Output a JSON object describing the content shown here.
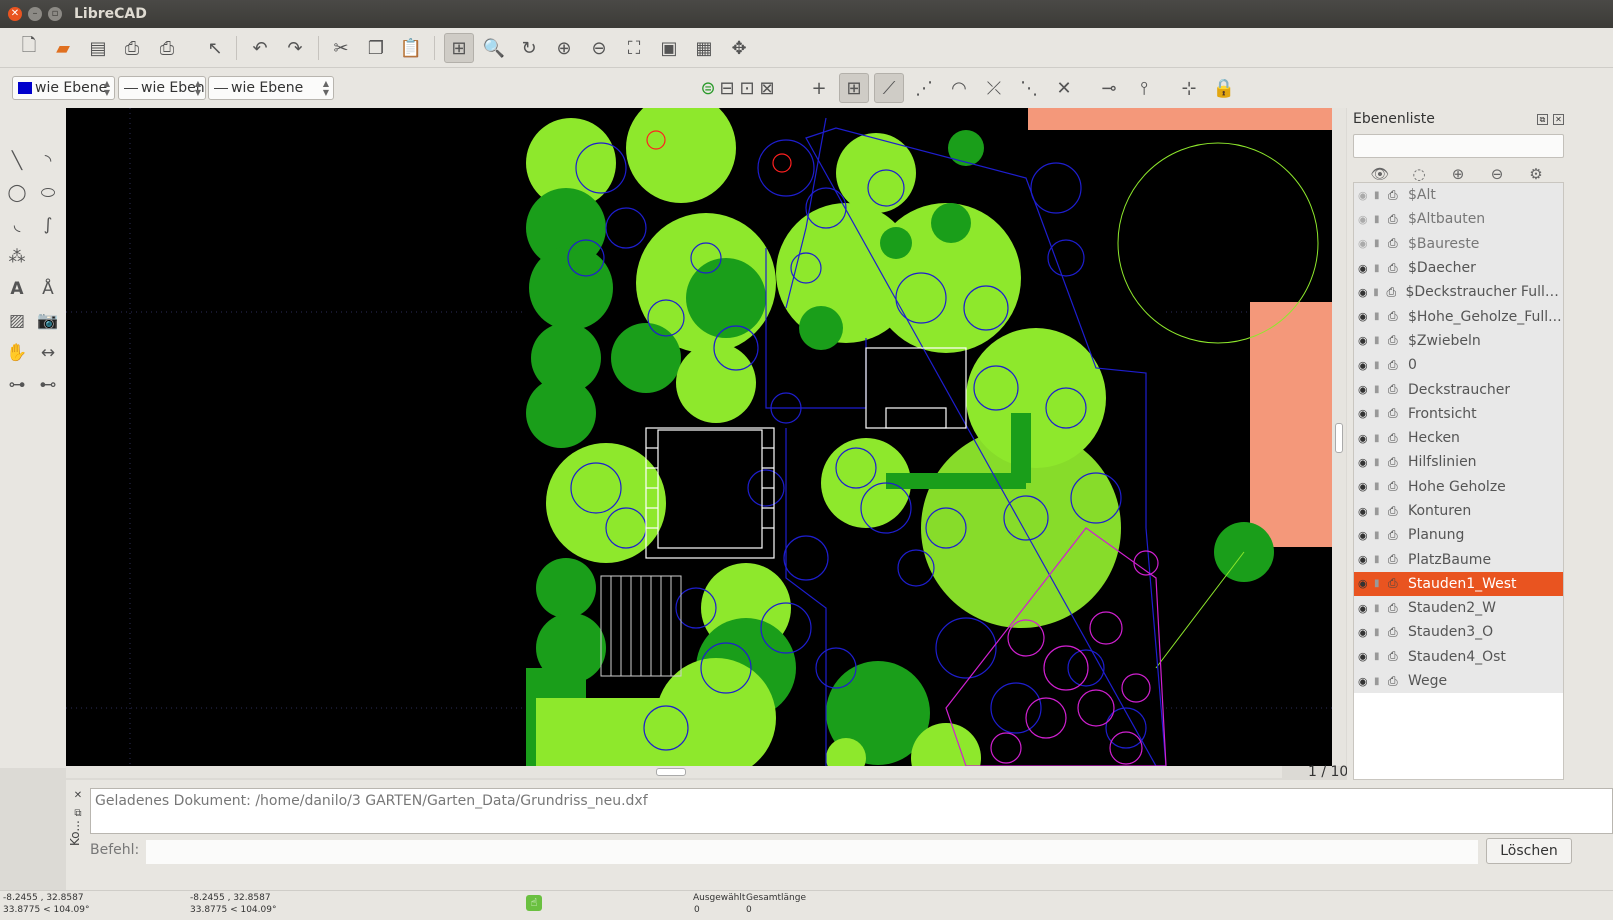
{
  "window": {
    "title": "LibreCAD"
  },
  "pen_toolbar": {
    "color_label": "wie Ebene",
    "color_swatch": "#0000cc",
    "linetype_label": "wie Ebene",
    "linewidth_label": "wie Ebene"
  },
  "toolbar_icons": {
    "file": [
      "new-icon",
      "open-icon",
      "save-icon",
      "print-icon",
      "print-preview-icon",
      "select-pointer-icon"
    ],
    "edit": [
      "undo-icon",
      "redo-icon",
      "cut-icon",
      "copy-icon",
      "paste-icon"
    ],
    "view": [
      "grid-icon",
      "zoom-pan-icon",
      "redraw-icon",
      "zoom-in-icon",
      "zoom-out-icon",
      "zoom-auto-icon",
      "zoom-previous-icon",
      "zoom-window-icon",
      "zoom-pan-tool-icon"
    ],
    "snap": [
      "snap-free-icon",
      "snap-exclusive-icon",
      "snap-grid-icon",
      "snap-endpoint-icon",
      "snap-onentity-icon",
      "snap-center-icon",
      "snap-middle-icon",
      "snap-distance-icon",
      "snap-intersection-icon",
      "restrict-horizontal-icon",
      "restrict-vertical-icon",
      "relative-zero-icon",
      "lock-relative-zero-icon"
    ]
  },
  "layer_panel": {
    "title": "Ebenenliste",
    "layers": [
      {
        "name": "$Alt",
        "visible": false
      },
      {
        "name": "$Altbauten",
        "visible": false
      },
      {
        "name": "$Baureste",
        "visible": false
      },
      {
        "name": "$Daecher",
        "visible": true
      },
      {
        "name": "$Deckstraucher Fullung",
        "visible": true
      },
      {
        "name": "$Hohe_Geholze_Full...",
        "visible": true
      },
      {
        "name": "$Zwiebeln",
        "visible": true
      },
      {
        "name": "0",
        "visible": true
      },
      {
        "name": "Deckstraucher",
        "visible": true
      },
      {
        "name": "Frontsicht",
        "visible": true
      },
      {
        "name": "Hecken",
        "visible": true
      },
      {
        "name": "Hilfslinien",
        "visible": true
      },
      {
        "name": "Hohe Geholze",
        "visible": true
      },
      {
        "name": "Konturen",
        "visible": true
      },
      {
        "name": "Planung",
        "visible": true
      },
      {
        "name": "PlatzBaume",
        "visible": true
      },
      {
        "name": "Stauden1_West",
        "visible": true,
        "selected": true
      },
      {
        "name": "Stauden2_W",
        "visible": true
      },
      {
        "name": "Stauden3_O",
        "visible": true
      },
      {
        "name": "Stauden4_Ost",
        "visible": true
      },
      {
        "name": "Wege",
        "visible": true
      }
    ]
  },
  "drawing": {
    "page_indicator": "1 / 10",
    "colors": {
      "background": "#000000",
      "tree_light": "#8ee82c",
      "tree_dark": "#1a9e1a",
      "lines_blue": "#1e1ecf",
      "lines_magenta": "#d020d0",
      "roof": "#f4987a",
      "grid": "#3a3a6a"
    }
  },
  "command": {
    "history": "Geladenes Dokument: /home/danilo/3 GARTEN/Garten_Data/Grundriss_neu.dxf",
    "prompt_label": "Befehl:",
    "clear_button": "Löschen",
    "side_label": "Ko..."
  },
  "status": {
    "abs_coord_1": "-8.2455 , 32.8587",
    "abs_coord_2": "33.8775 < 104.09°",
    "rel_coord_1": "-8.2455 , 32.8587",
    "rel_coord_2": "33.8775 < 104.09°",
    "selected_label": "Ausgewählt",
    "selected_value": "0",
    "total_length_label": "Gesamtlänge",
    "total_length_value": "0"
  }
}
